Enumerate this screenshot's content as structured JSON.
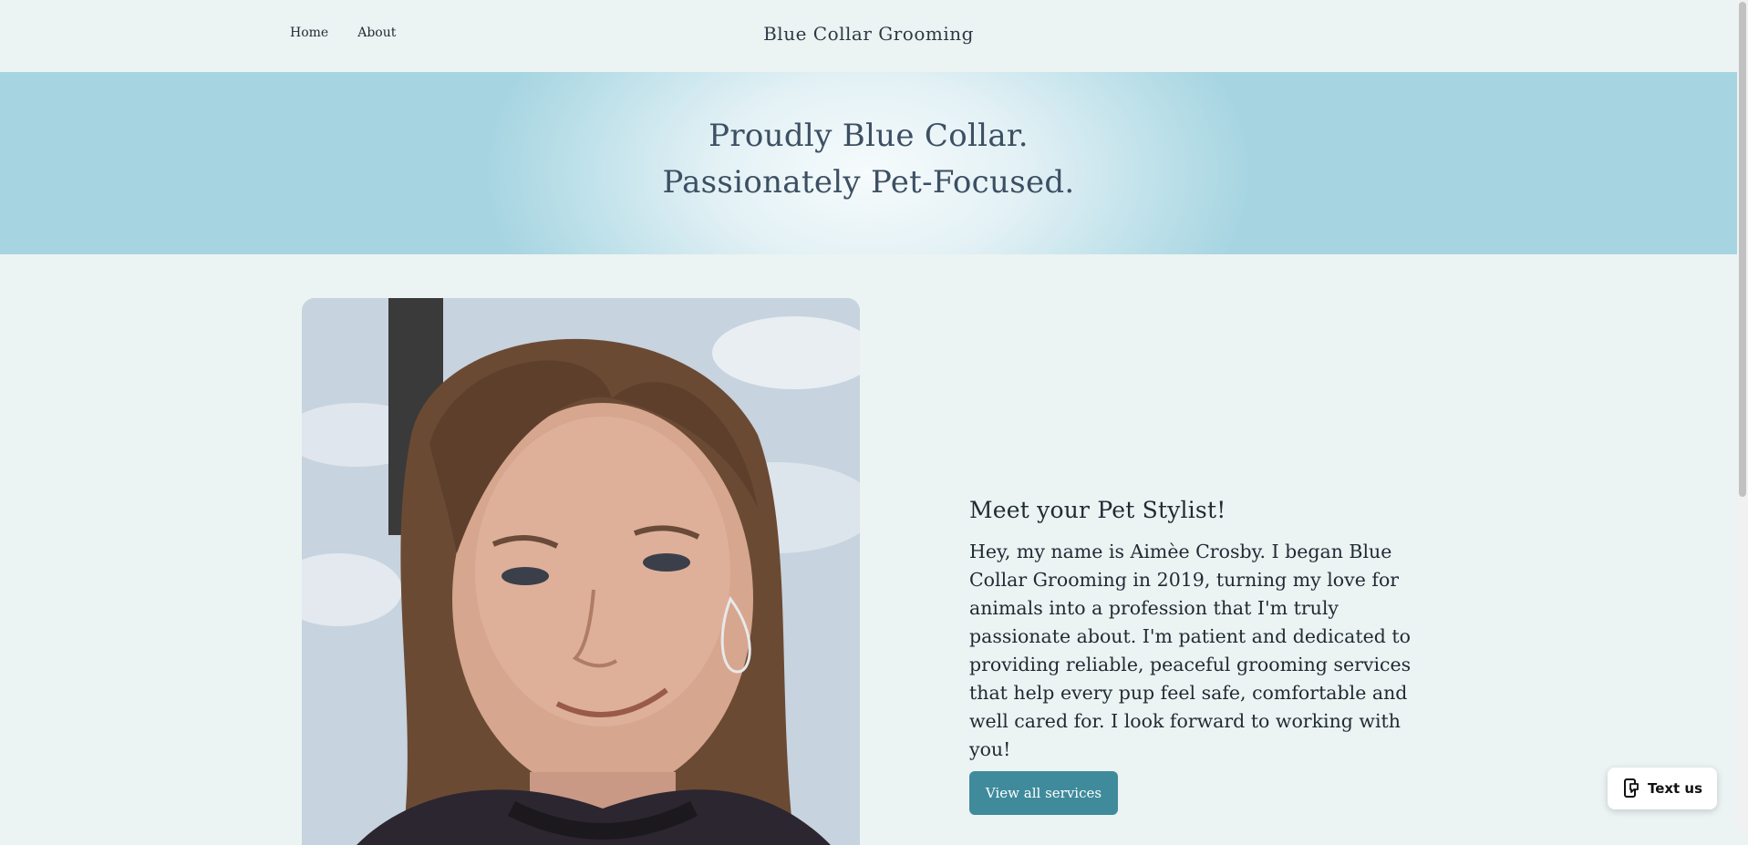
{
  "header": {
    "nav": [
      {
        "label": "Home"
      },
      {
        "label": "About"
      }
    ],
    "brand": "Blue Collar Grooming"
  },
  "hero": {
    "line1": "Proudly Blue Collar.",
    "line2": "Passionately Pet-Focused."
  },
  "about": {
    "title": "Meet your Pet Stylist!",
    "body": "Hey, my name is Aimèe Crosby. I began Blue Collar Grooming in 2019, turning my love for animals into a profession that I'm truly passionate about. I'm patient and dedicated to providing reliable, peaceful grooming services that help every pup feel safe, comfortable and well cared for. I look forward to working with you!",
    "button_label": "View all services"
  },
  "widget": {
    "label": "Text us",
    "icon": "phone-chat-icon"
  },
  "colors": {
    "background": "#ecf3f3",
    "accent_button": "#3f8b9c",
    "hero_edge": "#a6d5e1",
    "text": "#1f2b33"
  }
}
